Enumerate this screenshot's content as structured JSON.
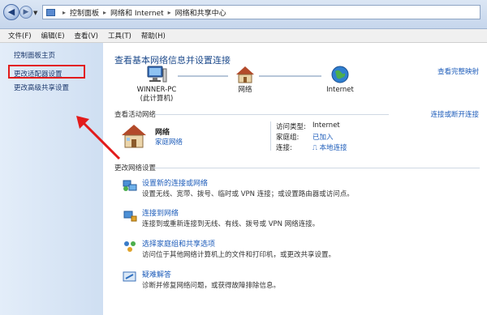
{
  "address_bar": {
    "crumbs": [
      "控制面板",
      "网络和 Internet",
      "网络和共享中心"
    ]
  },
  "menu": [
    "文件(F)",
    "编辑(E)",
    "查看(V)",
    "工具(T)",
    "帮助(H)"
  ],
  "sidebar": {
    "items": [
      {
        "label": "控制面板主页"
      },
      {
        "label": "更改适配器设置"
      },
      {
        "label": "更改高级共享设置"
      }
    ]
  },
  "main": {
    "title": "查看基本网络信息并设置连接",
    "full_map_link": "查看完整映射",
    "map": {
      "computer_name": "WINNER-PC",
      "computer_sub": "(此计算机)",
      "network": "网络",
      "internet": "Internet"
    },
    "active": {
      "header": "查看活动网络",
      "connect_link": "连接或断开连接",
      "network_name": "网络",
      "network_type": "家庭网络",
      "props": [
        {
          "label": "访问类型:",
          "value": "Internet"
        },
        {
          "label": "家庭组:",
          "value": "已加入"
        },
        {
          "label": "连接:",
          "value": "本地连接"
        }
      ]
    },
    "change": {
      "header": "更改网络设置",
      "tasks": [
        {
          "link": "设置新的连接或网络",
          "desc": "设置无线、宽带、拨号、临时或 VPN 连接；或设置路由器或访问点。"
        },
        {
          "link": "连接到网络",
          "desc": "连接到或重新连接到无线、有线、拨号或 VPN 网络连接。"
        },
        {
          "link": "选择家庭组和共享选项",
          "desc": "访问位于其他网络计算机上的文件和打印机，或更改共享设置。"
        },
        {
          "link": "疑难解答",
          "desc": "诊断并修复网络问题，或获得故障排除信息。"
        }
      ]
    }
  },
  "colors": {
    "link": "#1d5cba",
    "annotation": "#e21b1b",
    "sidebar": "#d6e4f5"
  },
  "icons": [
    "back-arrow-icon",
    "forward-arrow-icon",
    "computer-icon",
    "house-icon",
    "globe-icon",
    "network-setup-icon",
    "connect-icon",
    "homegroup-icon",
    "troubleshoot-icon"
  ]
}
